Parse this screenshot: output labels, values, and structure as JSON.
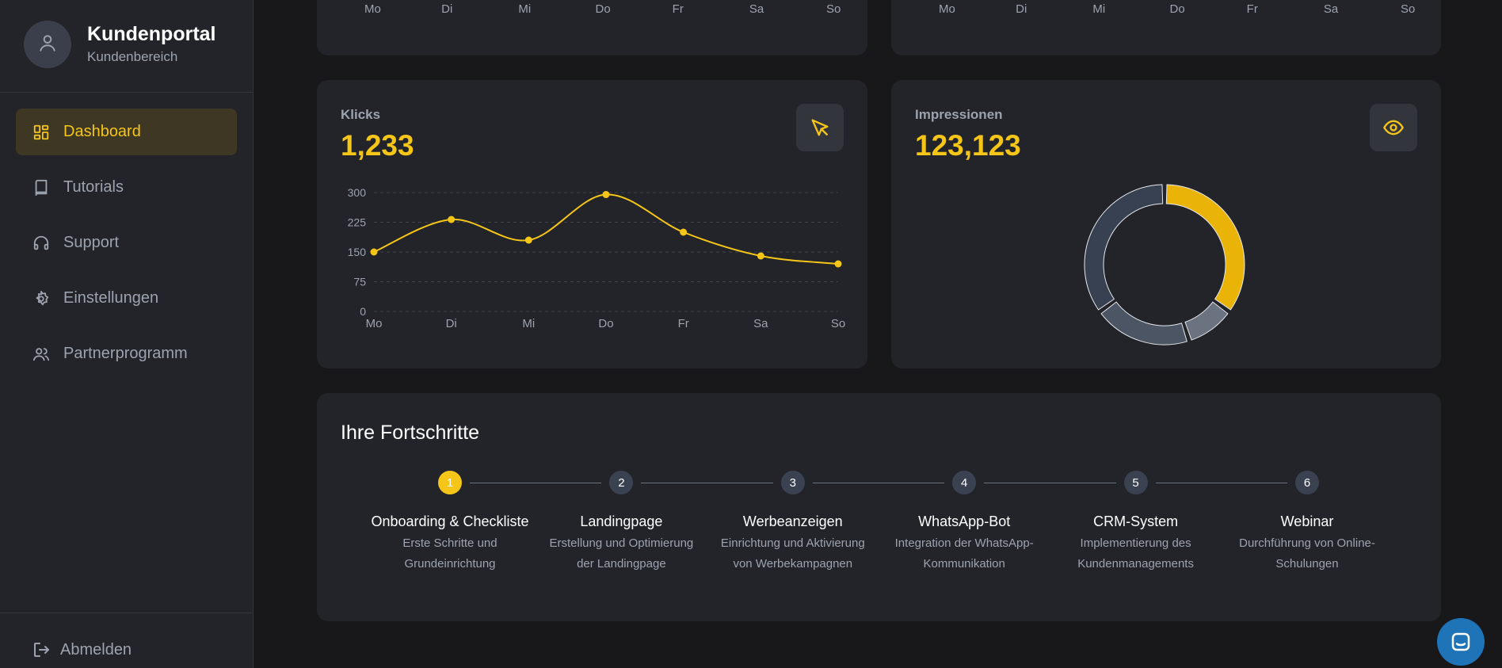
{
  "sidebar": {
    "brand_title": "Kundenportal",
    "brand_subtitle": "Kundenbereich",
    "items": [
      {
        "label": "Dashboard",
        "icon": "dashboard-icon",
        "active": true
      },
      {
        "label": "Tutorials",
        "icon": "book-icon",
        "active": false
      },
      {
        "label": "Support",
        "icon": "headset-icon",
        "active": false
      },
      {
        "label": "Einstellungen",
        "icon": "gear-icon",
        "active": false
      },
      {
        "label": "Partnerprogramm",
        "icon": "users-icon",
        "active": false
      }
    ],
    "logout_label": "Abmelden"
  },
  "top_cards": {
    "days": [
      "Mo",
      "Di",
      "Mi",
      "Do",
      "Fr",
      "Sa",
      "So"
    ]
  },
  "clicks_card": {
    "label": "Klicks",
    "value": "1,233",
    "icon": "cursor-icon"
  },
  "impressions_card": {
    "label": "Impressionen",
    "value": "123,123",
    "icon": "eye-icon"
  },
  "chart_data": [
    {
      "type": "line",
      "x": [
        "Mo",
        "Di",
        "Mi",
        "Do",
        "Fr",
        "Sa",
        "So"
      ],
      "y": [
        150,
        232,
        180,
        295,
        200,
        140,
        120
      ],
      "yticks": [
        0,
        75,
        150,
        225,
        300
      ],
      "ylim": [
        0,
        300
      ],
      "grid": true,
      "color": "#f5c518"
    },
    {
      "type": "pie",
      "style": "donut",
      "values": [
        35,
        10,
        20,
        35
      ],
      "colors": [
        "#eab308",
        "#6b7280",
        "#4b5563",
        "#374151"
      ]
    }
  ],
  "progress": {
    "title": "Ihre Fortschritte",
    "steps": [
      {
        "number": "1",
        "title": "Onboarding & Checkliste",
        "desc1": "Erste Schritte und",
        "desc2": "Grundeinrichtung",
        "done": true
      },
      {
        "number": "2",
        "title": "Landingpage",
        "desc1": "Erstellung und Optimierung",
        "desc2": "der Landingpage",
        "done": false
      },
      {
        "number": "3",
        "title": "Werbeanzeigen",
        "desc1": "Einrichtung und Aktivierung",
        "desc2": "von Werbekampagnen",
        "done": false
      },
      {
        "number": "4",
        "title": "WhatsApp-Bot",
        "desc1": "Integration der WhatsApp-",
        "desc2": "Kommunikation",
        "done": false
      },
      {
        "number": "5",
        "title": "CRM-System",
        "desc1": "Implementierung des",
        "desc2": "Kundenmanagements",
        "done": false
      },
      {
        "number": "6",
        "title": "Webinar",
        "desc1": "Durchführung von Online-",
        "desc2": "Schulungen",
        "done": false
      }
    ]
  },
  "colors": {
    "accent": "#f5c518",
    "background": "#18181b",
    "card": "#232429",
    "chat_button": "#1f74b8"
  }
}
